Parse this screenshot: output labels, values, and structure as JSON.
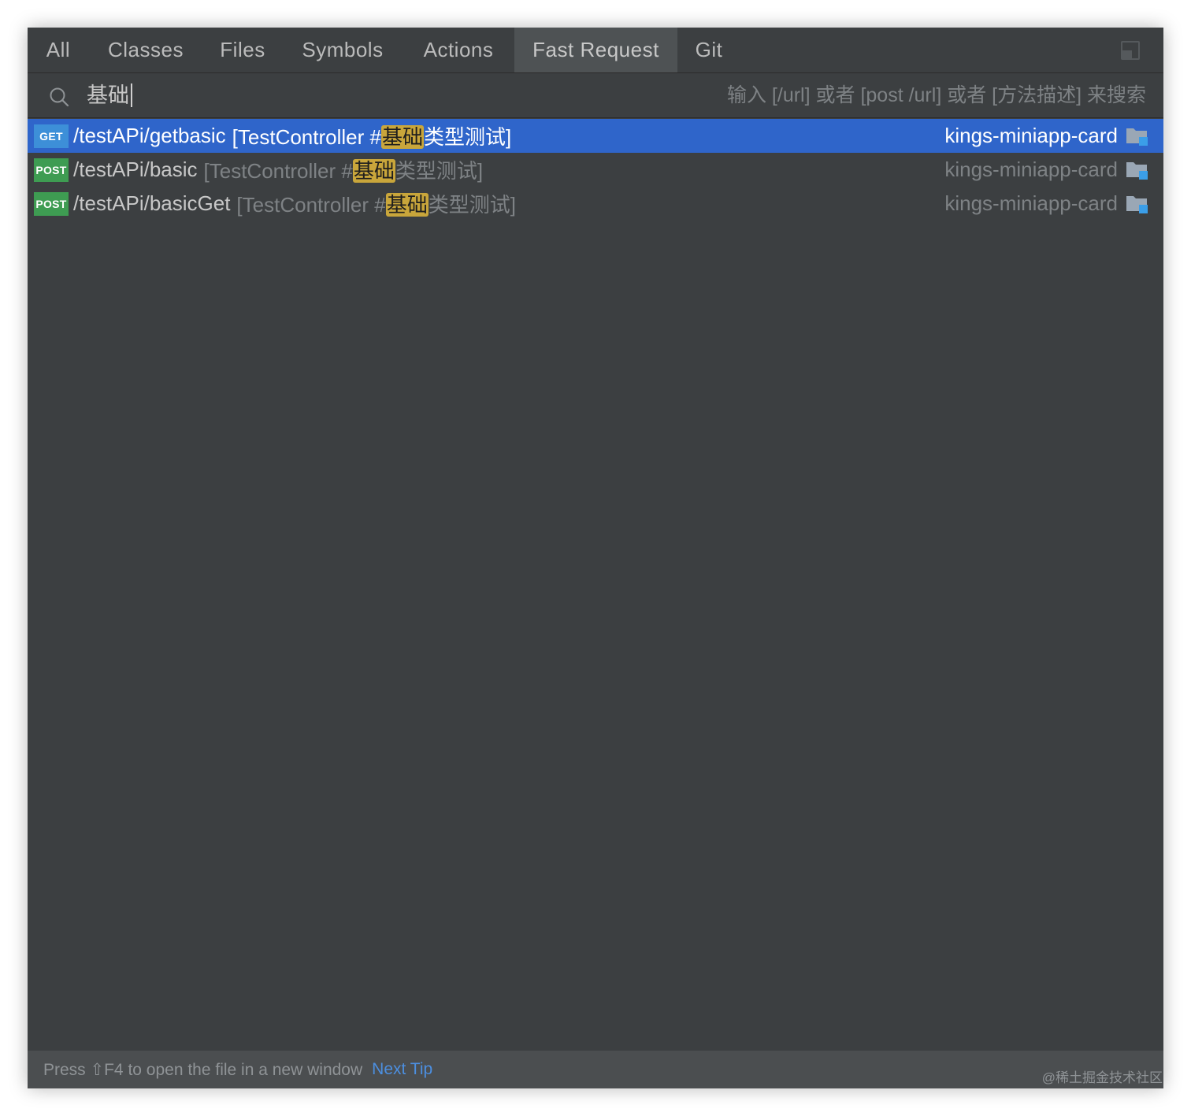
{
  "tabs": [
    {
      "label": "All",
      "active": false
    },
    {
      "label": "Classes",
      "active": false
    },
    {
      "label": "Files",
      "active": false
    },
    {
      "label": "Symbols",
      "active": false
    },
    {
      "label": "Actions",
      "active": false
    },
    {
      "label": "Fast Request",
      "active": true
    },
    {
      "label": "Git",
      "active": false
    }
  ],
  "search": {
    "value": "基础",
    "hint": "输入 [/url] 或者 [post /url] 或者 [方法描述] 来搜索"
  },
  "results": [
    {
      "method": "GET",
      "path": "/testAPi/getbasic",
      "desc_prefix": "[TestController #",
      "desc_highlight": "基础",
      "desc_suffix": "类型测试]",
      "module": "kings-miniapp-card",
      "selected": true
    },
    {
      "method": "POST",
      "path": "/testAPi/basic",
      "desc_prefix": "[TestController #",
      "desc_highlight": "基础",
      "desc_suffix": "类型测试]",
      "module": "kings-miniapp-card",
      "selected": false
    },
    {
      "method": "POST",
      "path": "/testAPi/basicGet",
      "desc_prefix": "[TestController #",
      "desc_highlight": "基础",
      "desc_suffix": "类型测试]",
      "module": "kings-miniapp-card",
      "selected": false
    }
  ],
  "footer": {
    "tip": "Press ⇧F4 to open the file in a new window",
    "next_tip": "Next Tip"
  },
  "watermark": "@稀土掘金技术社区",
  "colors": {
    "background": "#3c3f41",
    "selection": "#2f65ca",
    "get_badge": "#3d8fd8",
    "post_badge": "#3e9c52",
    "match_highlight": "#c9a63b",
    "link": "#4c8fe0"
  }
}
